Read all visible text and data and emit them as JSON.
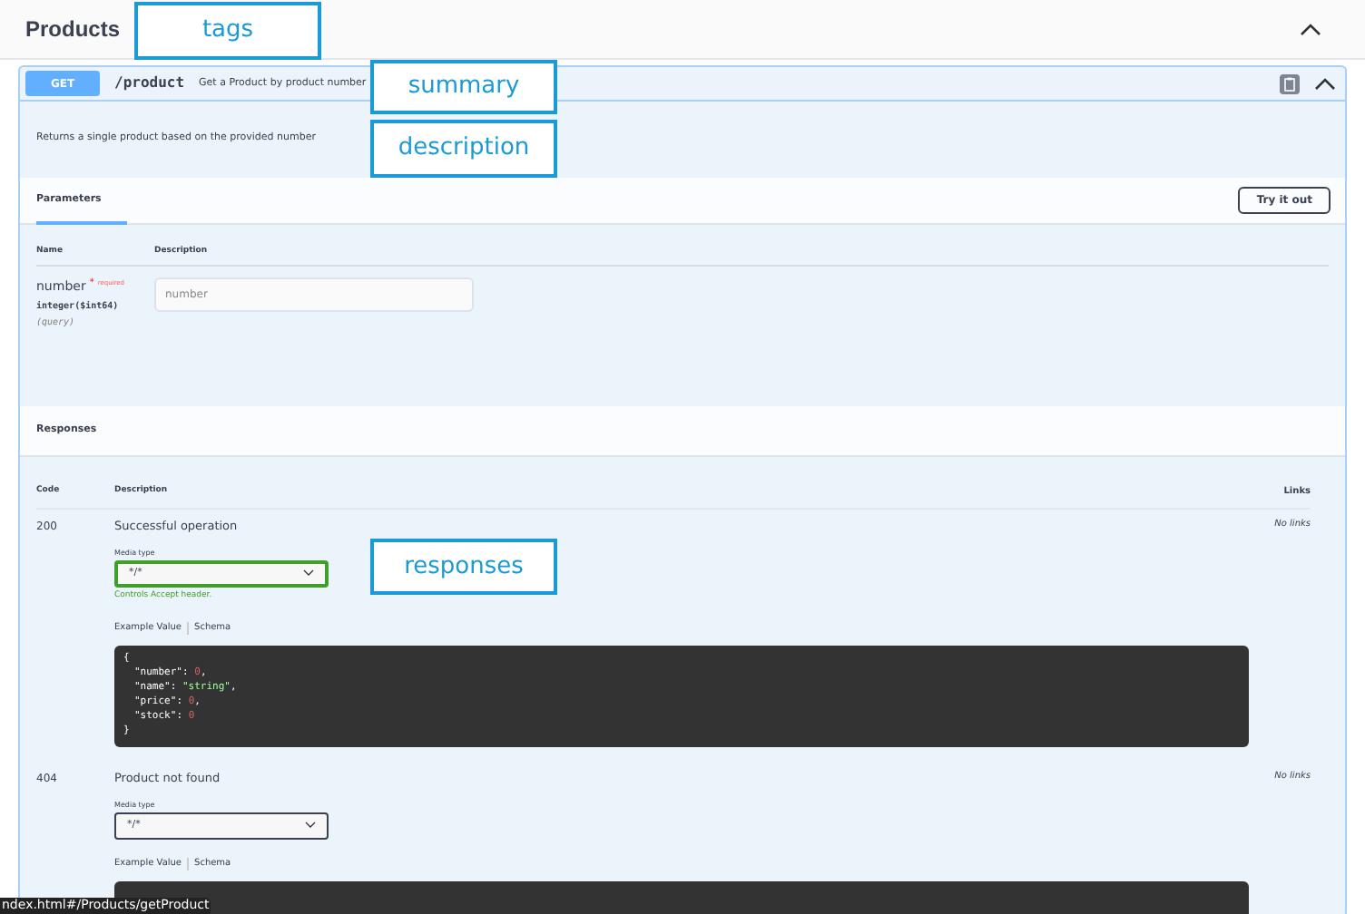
{
  "tag": {
    "title": "Products",
    "expanded": true
  },
  "operation": {
    "method": "GET",
    "path": "/product",
    "summary": "Get a Product by product number",
    "description": "Returns a single product based on the provided number",
    "expanded": true
  },
  "parameters": {
    "tab": "Parameters",
    "try_button": "Try it out",
    "columns": [
      "Name",
      "Description"
    ],
    "rows": [
      {
        "name": "number",
        "required_mark": "*",
        "required_label": "required",
        "type": "integer($int64)",
        "location": "(query)",
        "placeholder": "number"
      }
    ]
  },
  "responses": {
    "title": "Responses",
    "columns": [
      "Code",
      "Description",
      "Links"
    ],
    "rows": [
      {
        "code": "200",
        "description": "Successful operation",
        "media_label": "Media type",
        "media_value": "*/*",
        "validated": true,
        "note": "Controls Accept header.",
        "example_tab": "Example Value",
        "schema_tab": "Schema",
        "links": "No links",
        "example": [
          {
            "kind": "brace",
            "text": "{"
          },
          {
            "kind": "number",
            "key": "\"number\"",
            "separator": ":",
            "value": "0",
            "comma": ","
          },
          {
            "kind": "string",
            "key": "\"name\"",
            "separator": ":",
            "value": "\"string\"",
            "comma": ","
          },
          {
            "kind": "number",
            "key": "\"price\"",
            "separator": ":",
            "value": "0",
            "comma": ","
          },
          {
            "kind": "number",
            "key": "\"stock\"",
            "separator": ":",
            "value": "0"
          },
          {
            "kind": "brace",
            "text": "}"
          }
        ]
      },
      {
        "code": "404",
        "description": "Product not found",
        "media_label": "Media type",
        "media_value": "*/*",
        "validated": false,
        "example_tab": "Example Value",
        "schema_tab": "Schema",
        "links": "No links",
        "example": []
      }
    ]
  },
  "callouts": [
    {
      "text": "tags"
    },
    {
      "text": "summary"
    },
    {
      "text": "description"
    },
    {
      "text": "responses"
    }
  ],
  "status_bar": {
    "url": "ndex.html#/Products/getProduct"
  }
}
